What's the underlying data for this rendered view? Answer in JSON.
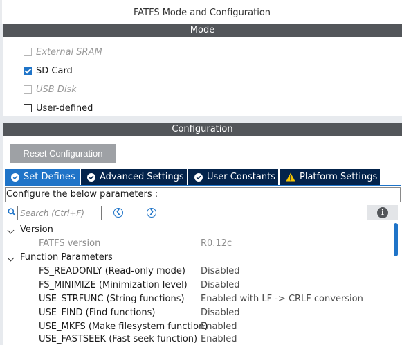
{
  "window": {
    "title": "FATFS Mode and Configuration"
  },
  "mode": {
    "header": "Mode",
    "items": [
      {
        "label": "External SRAM",
        "checked": false,
        "disabled": true
      },
      {
        "label": "SD Card",
        "checked": true,
        "disabled": false
      },
      {
        "label": "USB Disk",
        "checked": false,
        "disabled": true
      },
      {
        "label": "User-defined",
        "checked": false,
        "disabled": false
      }
    ]
  },
  "configuration": {
    "header": "Configuration",
    "reset_label": "Reset Configuration",
    "tabs": [
      {
        "label": "Set Defines",
        "icon": "check-circle-icon",
        "active": true
      },
      {
        "label": "Advanced Settings",
        "icon": "check-circle-icon",
        "active": false
      },
      {
        "label": "User Constants",
        "icon": "check-circle-icon",
        "active": false
      },
      {
        "label": "Platform Settings",
        "icon": "warning-icon",
        "active": false
      }
    ],
    "instructions": "Configure the below parameters :",
    "search": {
      "placeholder": "Search (Ctrl+F)",
      "value": ""
    },
    "tree": {
      "version_group": {
        "label": "Version",
        "params": [
          {
            "name": "FATFS version",
            "value": "R0.12c"
          }
        ]
      },
      "function_group": {
        "label": "Function Parameters",
        "params": [
          {
            "name": "FS_READONLY (Read-only mode)",
            "value": "Disabled"
          },
          {
            "name": "FS_MINIMIZE (Minimization level)",
            "value": "Disabled"
          },
          {
            "name": "USE_STRFUNC (String functions)",
            "value": "Enabled with LF -> CRLF conversion"
          },
          {
            "name": "USE_FIND (Find functions)",
            "value": "Disabled"
          },
          {
            "name": "USE_MKFS (Make filesystem function)",
            "value": "Enabled"
          },
          {
            "name": "USE_FASTSEEK (Fast seek function)",
            "value": "Enabled"
          }
        ]
      }
    }
  },
  "colors": {
    "accent": "#1f74c8",
    "tab_dark": "#03234b",
    "header_bg": "#53565a",
    "button_gray": "#9ea1a5",
    "warning": "#f5c400"
  }
}
